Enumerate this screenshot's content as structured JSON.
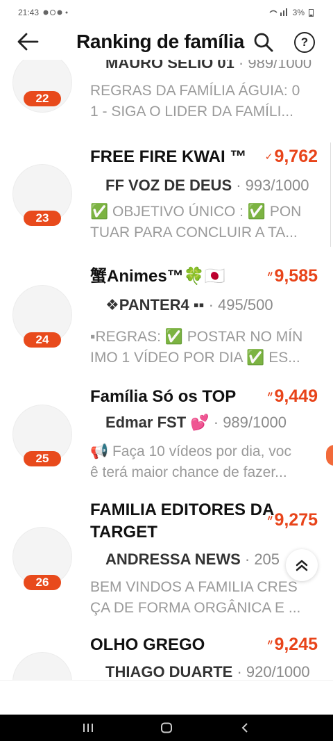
{
  "status": {
    "time": "21:43",
    "battery": "3%"
  },
  "header": {
    "title": "Ranking de família",
    "help_label": "?"
  },
  "families": [
    {
      "rank": "22",
      "name": "",
      "points": "",
      "leader": "MAURO SELIO 01",
      "members": " · 989/1000",
      "desc": "REGRAS DA FAMÍLIA ÁGUIA: 0\n1 - SIGA O LIDER DA FAMÍLI..."
    },
    {
      "rank": "23",
      "name": "FREE FIRE KWAI ™",
      "points": "9,762",
      "leader": "FF VOZ DE DEUS",
      "members": " · 993/1000",
      "desc": "✅ OBJETIVO ÚNICO : ✅ PON\nTUAR PARA CONCLUIR A TA..."
    },
    {
      "rank": "24",
      "name": "蟹Animes™🍀🇯🇵",
      "points": "9,585",
      "leader": "❖PANTER4 ▪▪",
      "members": " · 495/500",
      "desc": "▪REGRAS: ✅ POSTAR NO MÍN\nIMO 1 VÍDEO POR DIA ✅ ES..."
    },
    {
      "rank": "25",
      "name": "Família Só os TOP",
      "points": "9,449",
      "leader": "Edmar FST 💕",
      "members": " · 989/1000",
      "desc": "📢 Faça 10 vídeos por dia, voc\nê terá maior chance de fazer..."
    },
    {
      "rank": "26",
      "name": "FAMILIA EDITORES DA TARGET",
      "points": "9,275",
      "leader": "ANDRESSA NEWS",
      "members": " · 205/",
      "desc": "BEM VINDOS A FAMILIA CRES\nÇA DE FORMA ORGÂNICA E ..."
    },
    {
      "rank": "27",
      "name": "OLHO GREGO",
      "points": "9,245",
      "leader": "THIAGO DUARTE",
      "members": " · 920/1000",
      "desc": ""
    }
  ]
}
